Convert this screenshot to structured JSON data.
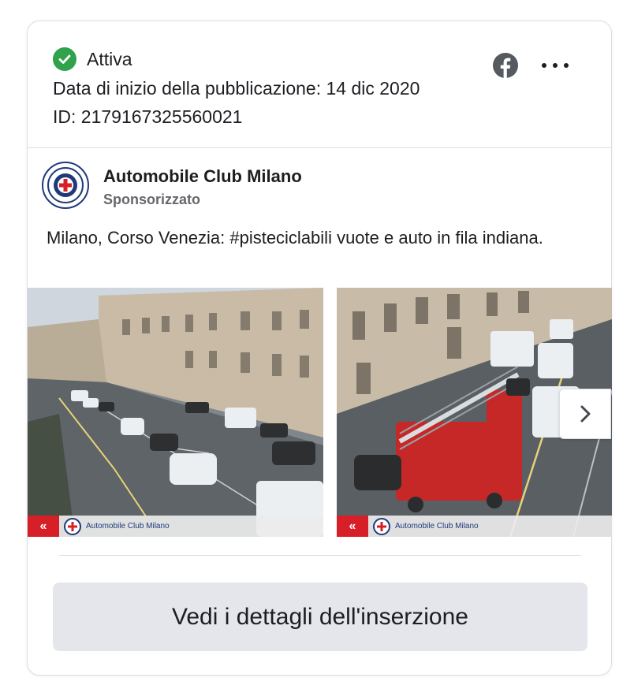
{
  "status": {
    "label": "Attiva",
    "color": "#31a24c"
  },
  "publication": {
    "start_date_text": "Data di inizio della pubblicazione: 14 dic 2020",
    "id_text": "ID: 2179167325560021"
  },
  "header_icons": {
    "facebook": "facebook-icon",
    "more": "more-options-icon"
  },
  "ad": {
    "page_name": "Automobile Club Milano",
    "sponsored_label": "Sponsorizzato",
    "body_text": "Milano, Corso Venezia: #pisteciclabili vuote e auto in fila indiana.",
    "carousel": [
      {
        "watermark": "Automobile Club Milano"
      },
      {
        "watermark": "Automobile Club Milano"
      }
    ],
    "next_icon": "chevron-right-icon"
  },
  "cta": {
    "label": "Vedi i dettagli dell'inserzione"
  }
}
